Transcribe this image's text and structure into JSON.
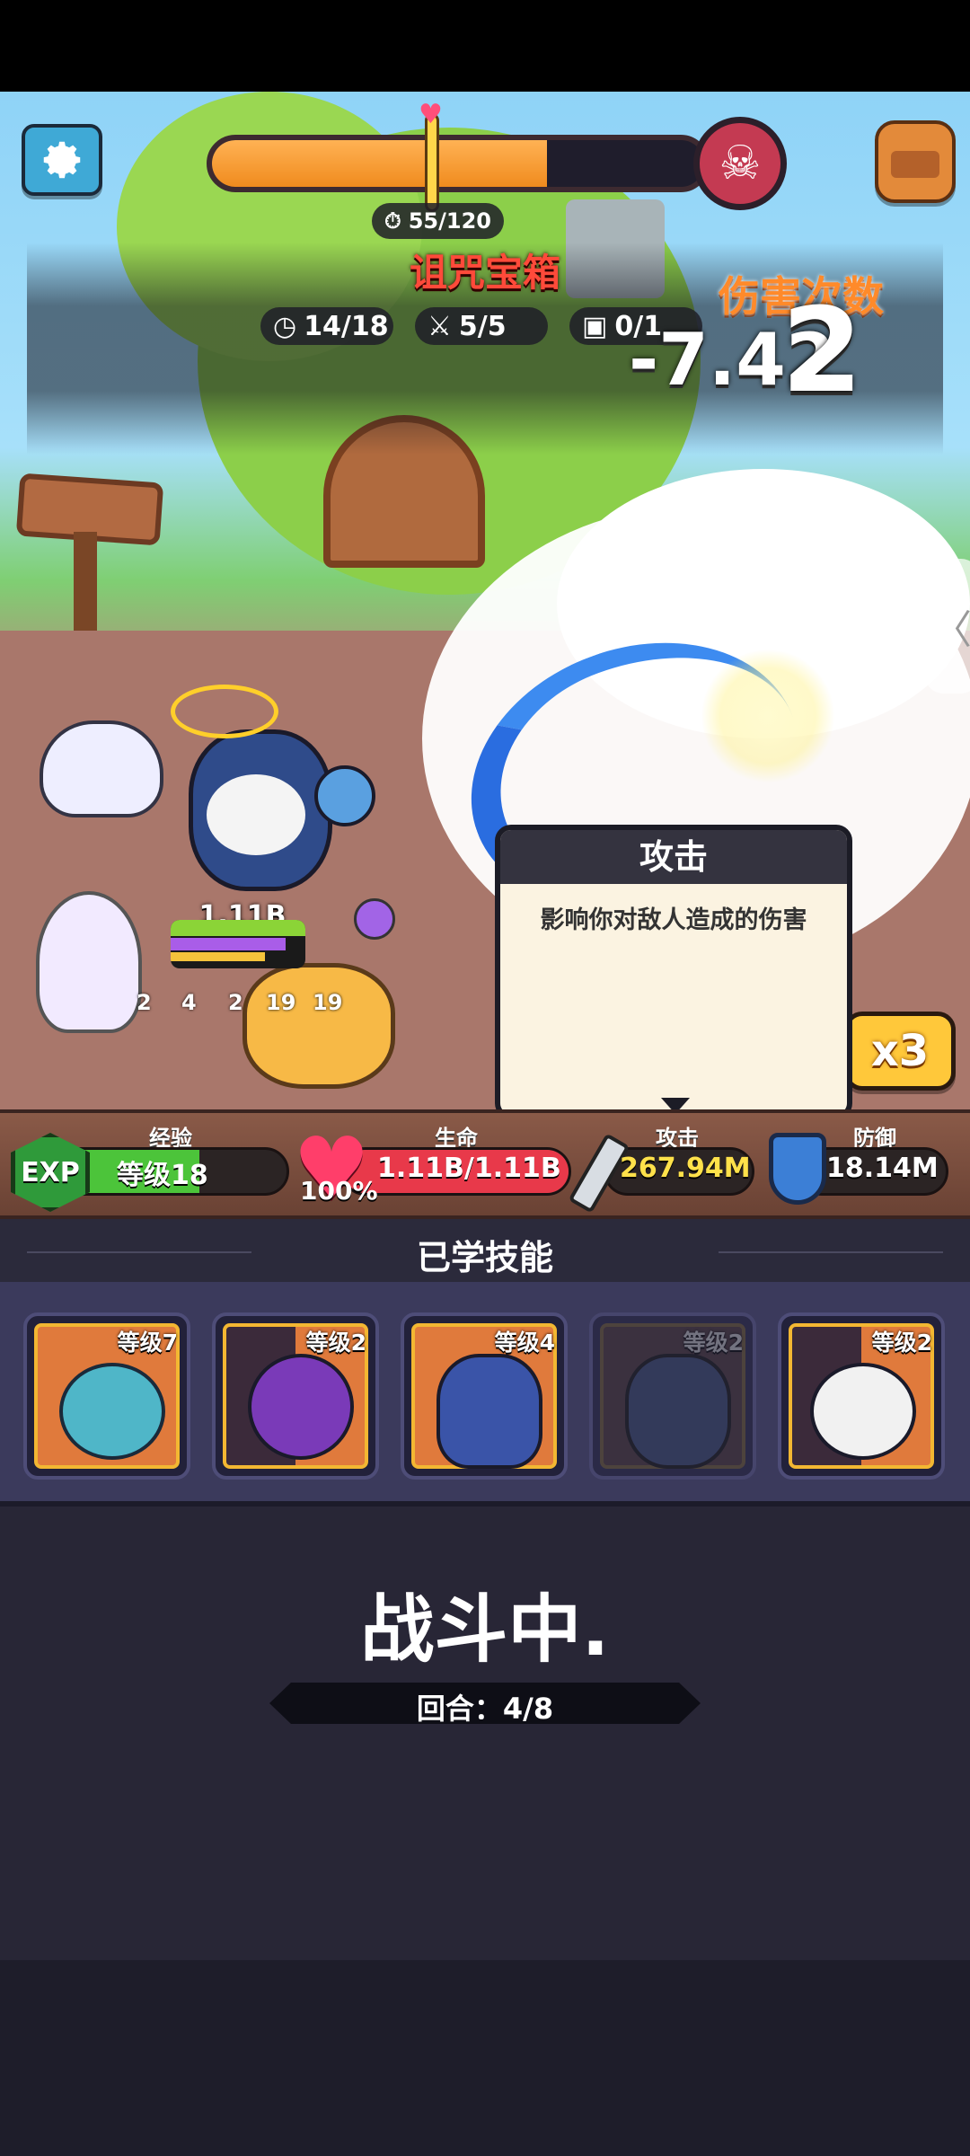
{
  "stage": {
    "timer": "55/120",
    "boss_progress_percent": 68,
    "event_title": "诅咒宝箱",
    "counters": {
      "time": "14/18",
      "battles": "5/5",
      "chests": "0/1"
    },
    "damage_count_label": "伤害次数",
    "damage_number": "-7.42",
    "hit_count": "2"
  },
  "hero": {
    "power": "1.11B",
    "minions": [
      "2",
      "4",
      "2",
      "19",
      "19"
    ]
  },
  "speed_button": "x3",
  "tooltip": {
    "title": "攻击",
    "description": "影响你对敌人造成的伤害"
  },
  "stats": {
    "exp": {
      "label": "经验",
      "badge": "EXP",
      "level": "等级18",
      "fill_fraction": 0.62
    },
    "hp": {
      "label": "生命",
      "percent": "100%",
      "value": "1.11B/1.11B",
      "fill_fraction": 1.0
    },
    "attack": {
      "label": "攻击",
      "value": "267.94M"
    },
    "defense": {
      "label": "防御",
      "value": "18.14M"
    }
  },
  "skills": {
    "title": "已学技能",
    "items": [
      {
        "level": "等级7",
        "icon": "troll-icon"
      },
      {
        "level": "等级2",
        "icon": "eye-monster-icon"
      },
      {
        "level": "等级4",
        "icon": "pharaoh-skull-icon"
      },
      {
        "level": "等级2",
        "icon": "bird-warrior-icon"
      },
      {
        "level": "等级2",
        "icon": "panda-chef-icon"
      }
    ]
  },
  "battle_status": {
    "text": "战斗中.",
    "round": "回合：4/8"
  },
  "colors": {
    "accent_orange": "#f59a31",
    "exp_green": "#4cc43a",
    "hp_red": "#e8394a",
    "attack_yellow": "#ffe14a",
    "title_red": "#ff4a3a"
  }
}
